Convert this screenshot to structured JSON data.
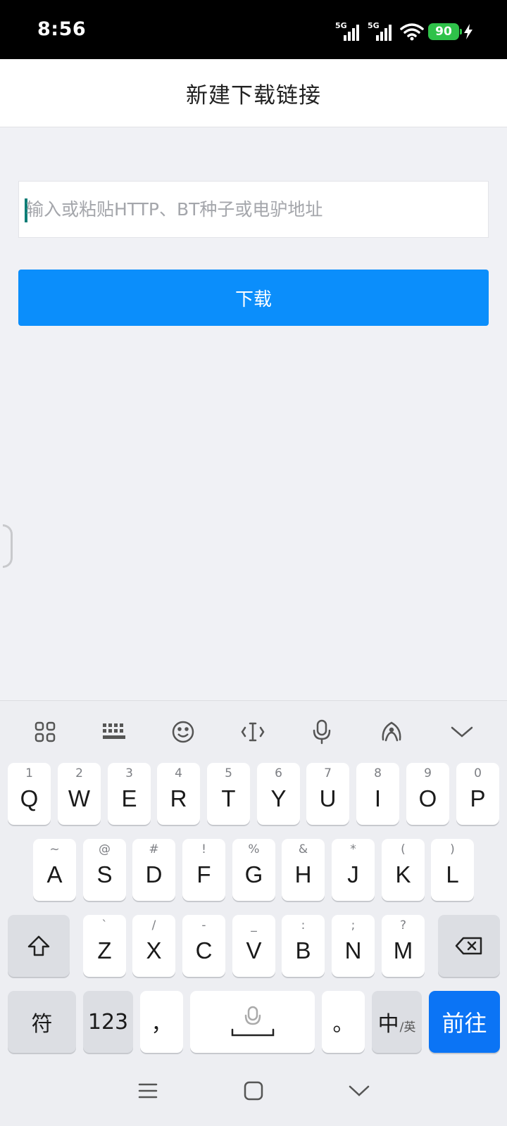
{
  "status_bar": {
    "time": "8:56",
    "signal_1": "5G",
    "signal_2": "5G",
    "battery": "90"
  },
  "header": {
    "title": "新建下载链接"
  },
  "url_input": {
    "placeholder": "输入或粘贴HTTP、BT种子或电驴地址",
    "value": ""
  },
  "download_button": {
    "label": "下载"
  },
  "keyboard": {
    "toolbar_icons": [
      "grid-icon",
      "keyboard-icon",
      "emoji-icon",
      "text-cursor-icon",
      "microphone-icon",
      "handwriting-icon",
      "chevron-down-icon"
    ],
    "row1": [
      {
        "main": "Q",
        "hint": "1"
      },
      {
        "main": "W",
        "hint": "2"
      },
      {
        "main": "E",
        "hint": "3"
      },
      {
        "main": "R",
        "hint": "4"
      },
      {
        "main": "T",
        "hint": "5"
      },
      {
        "main": "Y",
        "hint": "6"
      },
      {
        "main": "U",
        "hint": "7"
      },
      {
        "main": "I",
        "hint": "8"
      },
      {
        "main": "O",
        "hint": "9"
      },
      {
        "main": "P",
        "hint": "0"
      }
    ],
    "row2": [
      {
        "main": "A",
        "hint": "~"
      },
      {
        "main": "S",
        "hint": "@"
      },
      {
        "main": "D",
        "hint": "#"
      },
      {
        "main": "F",
        "hint": "!"
      },
      {
        "main": "G",
        "hint": "%"
      },
      {
        "main": "H",
        "hint": "&"
      },
      {
        "main": "J",
        "hint": "*"
      },
      {
        "main": "K",
        "hint": "("
      },
      {
        "main": "L",
        "hint": ")"
      }
    ],
    "row3": [
      {
        "main": "Z",
        "hint": "`"
      },
      {
        "main": "X",
        "hint": "/"
      },
      {
        "main": "C",
        "hint": "-"
      },
      {
        "main": "V",
        "hint": "_"
      },
      {
        "main": "B",
        "hint": ":"
      },
      {
        "main": "N",
        "hint": ";"
      },
      {
        "main": "M",
        "hint": "?"
      }
    ],
    "row4": {
      "symbols": "符",
      "numbers": "123",
      "comma": "，",
      "period": "。",
      "lang_main": "中",
      "lang_sub": "/英",
      "go": "前往"
    }
  },
  "nav_bar": [
    "menu-icon",
    "home-icon",
    "back-icon"
  ]
}
